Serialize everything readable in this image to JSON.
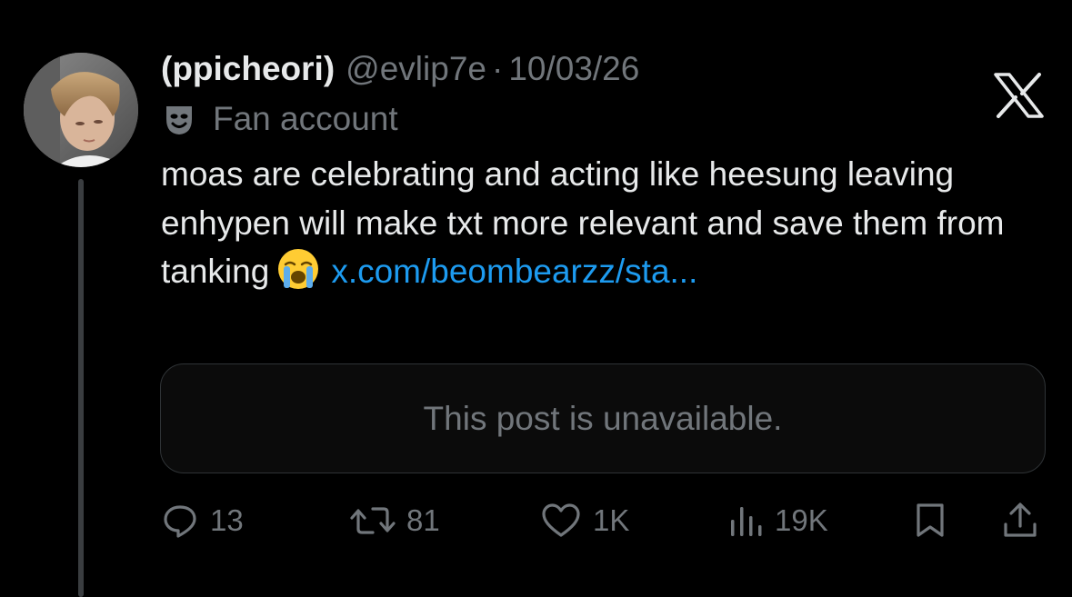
{
  "author": {
    "display_name": "(ppicheori)",
    "handle": "@evlip7e",
    "separator": "·",
    "date": "10/03/26",
    "label": "Fan account",
    "label_icon": "mask-icon"
  },
  "brand": {
    "logo_icon": "x-logo-icon"
  },
  "post": {
    "text_before_emoji": "moas are celebrating and acting like heesung leaving enhypen will make txt more relevant and save them from tanking",
    "emoji": "loudly-crying-face",
    "link_text": "x.com/beombearzz/sta..."
  },
  "quote": {
    "unavailable_text": "This post is unavailable."
  },
  "actions": {
    "replies": "13",
    "reposts": "81",
    "likes": "1K",
    "views": "19K",
    "icons": [
      "reply-icon",
      "repost-icon",
      "like-icon",
      "views-icon",
      "bookmark-icon",
      "share-icon"
    ]
  },
  "colors": {
    "background": "#000000",
    "text_primary": "#e7e9ea",
    "text_secondary": "#71767b",
    "link": "#1d9bf0",
    "border": "#2f3336"
  }
}
